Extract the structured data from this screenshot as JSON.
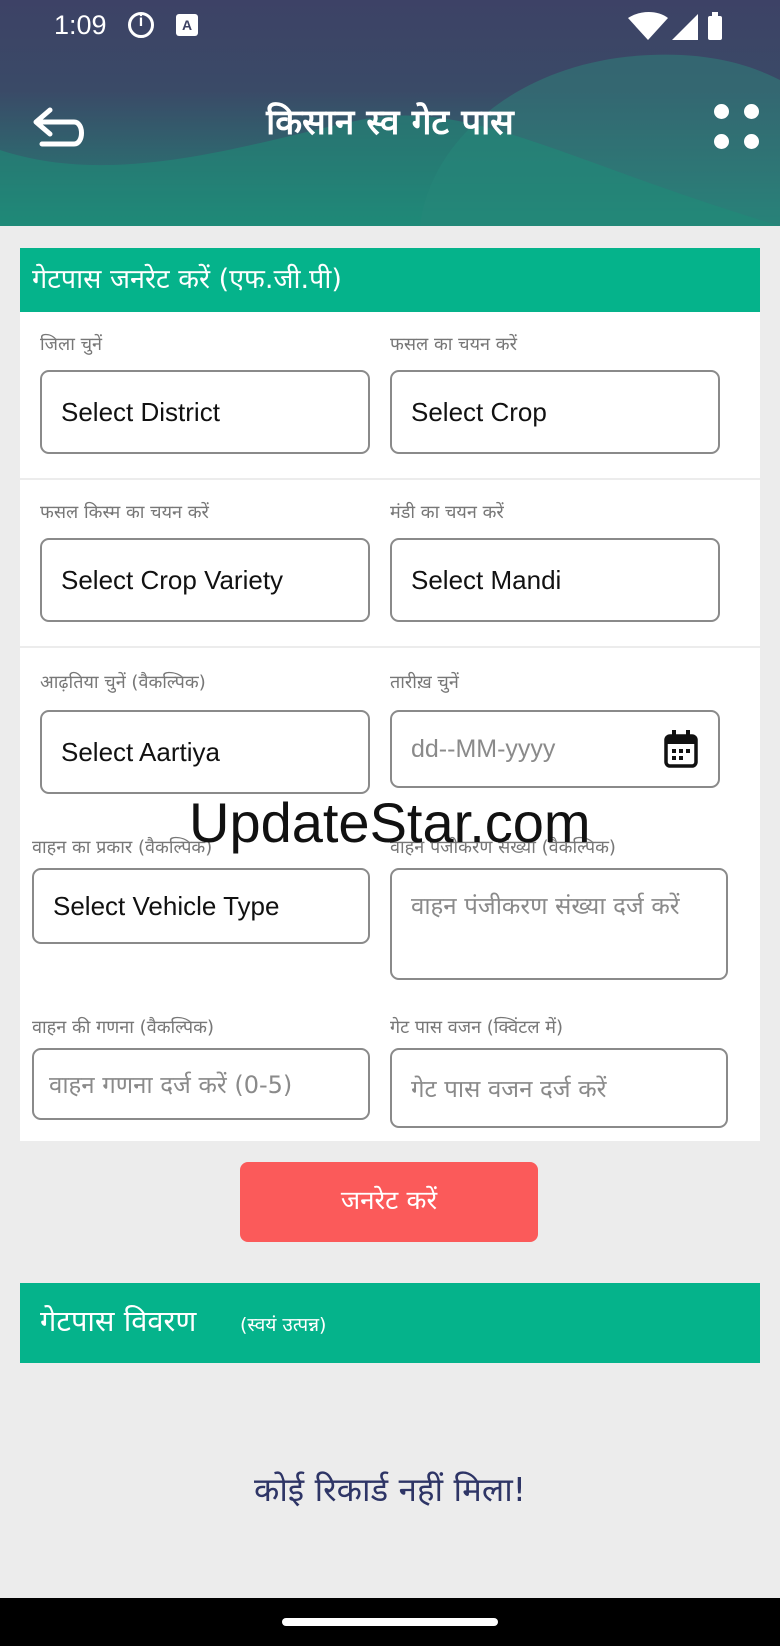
{
  "status": {
    "time": "1:09"
  },
  "header": {
    "title": "किसान स्व गेट पास"
  },
  "form": {
    "section_title": "गेटपास जनरेट करें (एफ.जी.पी)",
    "district": {
      "label": "जिला चुनें",
      "value": "Select District"
    },
    "crop": {
      "label": "फसल का चयन करें",
      "value": "Select Crop"
    },
    "crop_variety": {
      "label": "फसल किस्म का चयन करें",
      "value": "Select Crop Variety"
    },
    "mandi": {
      "label": "मंडी का चयन करें",
      "value": "Select Mandi"
    },
    "aartiya": {
      "label": "आढ़तिया चुनें (वैकल्पिक)",
      "value": "Select Aartiya"
    },
    "date": {
      "label": "तारीख़ चुनें",
      "placeholder": "dd--MM-yyyy"
    },
    "vehicle_type": {
      "label": "वाहन का प्रकार (वैकल्पिक)",
      "value": "Select Vehicle Type"
    },
    "vehicle_reg": {
      "label": "वाहन पंजीकरण संख्या (वैकल्पिक)",
      "placeholder": "वाहन पंजीकरण संख्या दर्ज करें"
    },
    "vehicle_count": {
      "label": "वाहन की गणना (वैकल्पिक)",
      "placeholder": "वाहन गणना दर्ज करें (0-5)"
    },
    "gatepass_weight": {
      "label": "गेट पास वजन (क्विंटल में)",
      "placeholder": "गेट पास वजन दर्ज करें"
    }
  },
  "generate_button": "जनरेट करें",
  "details": {
    "title": "गेटपास विवरण",
    "subtitle": "(स्वयं उत्पन्न)"
  },
  "empty_message": "कोई रिकार्ड नहीं मिला!",
  "watermark": "UpdateStar.com",
  "colors": {
    "accent": "#05b38b",
    "button": "#fb5a5a",
    "header_dark": "#3d4266"
  }
}
